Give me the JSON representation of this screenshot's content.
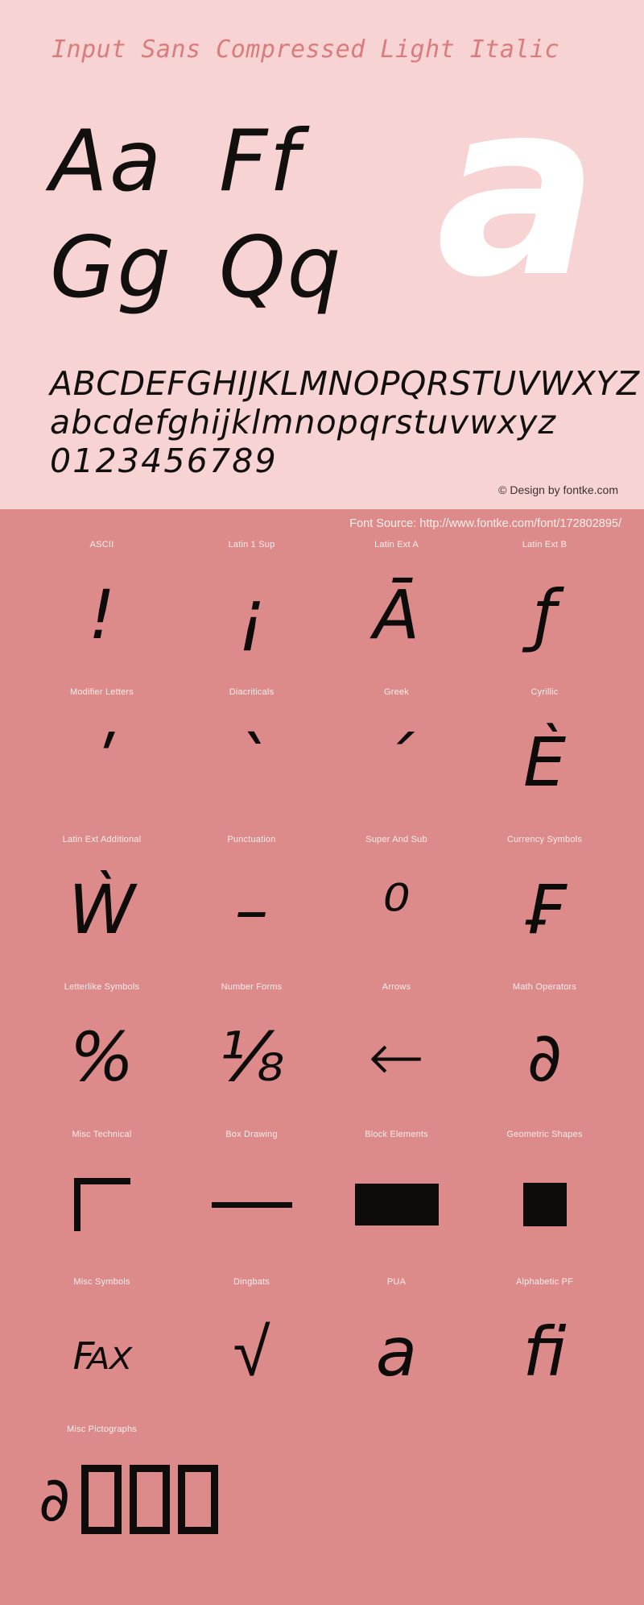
{
  "specimen": {
    "title": "Input Sans Compressed Light Italic",
    "watermark_glyph": "a",
    "letter_pairs": [
      [
        "Aa",
        "Ff"
      ],
      [
        "Gg",
        "Qq"
      ]
    ],
    "charset": {
      "uppercase": "ABCDEFGHIJKLMNOPQRSTUVWXYZ",
      "lowercase": "abcdefghijklmnopqrstuvwxyz",
      "digits": "0123456789"
    },
    "credit": "© Design by fontke.com",
    "source": "Font Source: http://www.fontke.com/font/172802895/"
  },
  "colors": {
    "top_background": "#f8d3d3",
    "bottom_background": "#dd8a8a",
    "title_text": "#d97c7c",
    "glyph_text": "#0d0c0b",
    "label_text": "#fbeeee",
    "watermark": "#ffffff"
  },
  "unicode_blocks": [
    [
      {
        "label": "ASCII",
        "glyph": "!",
        "style": ""
      },
      {
        "label": "Latin 1 Sup",
        "glyph": "¡",
        "style": ""
      },
      {
        "label": "Latin Ext A",
        "glyph": "Ā",
        "style": ""
      },
      {
        "label": "Latin Ext B",
        "glyph": "ƒ",
        "style": ""
      }
    ],
    [
      {
        "label": "Modifier Letters",
        "glyph": "ʹ",
        "style": ""
      },
      {
        "label": "Diacriticals",
        "glyph": "ˋ",
        "style": ""
      },
      {
        "label": "Greek",
        "glyph": "΄",
        "style": ""
      },
      {
        "label": "Cyrillic",
        "glyph": "Ѐ",
        "style": ""
      }
    ],
    [
      {
        "label": "Latin Ext Additional",
        "glyph": "Ẁ",
        "style": ""
      },
      {
        "label": "Punctuation",
        "glyph": "–",
        "style": ""
      },
      {
        "label": "Super And Sub",
        "glyph": "⁰",
        "style": ""
      },
      {
        "label": "Currency Symbols",
        "glyph": "₣",
        "style": ""
      }
    ],
    [
      {
        "label": "Letterlike Symbols",
        "glyph": "%",
        "style": ""
      },
      {
        "label": "Number Forms",
        "glyph": "⅛",
        "style": ""
      },
      {
        "label": "Arrows",
        "glyph": "←",
        "style": "upright"
      },
      {
        "label": "Math Operators",
        "glyph": "∂",
        "style": ""
      }
    ],
    [
      {
        "label": "Misc Technical",
        "glyph": "⌐",
        "style": "shape-corner"
      },
      {
        "label": "Box Drawing",
        "glyph": "─",
        "style": "shape-bar"
      },
      {
        "label": "Block Elements",
        "glyph": "▬",
        "style": "shape-blockel"
      },
      {
        "label": "Geometric Shapes",
        "glyph": "■",
        "style": "shape-square"
      }
    ],
    [
      {
        "label": "Misc Symbols",
        "glyph": "℻",
        "style": "small"
      },
      {
        "label": "Dingbats",
        "glyph": "√",
        "style": "upright"
      },
      {
        "label": "PUA",
        "glyph": "a",
        "style": ""
      },
      {
        "label": "Alphabetic PF",
        "glyph": "ﬁ",
        "style": ""
      }
    ],
    [
      {
        "label": "Misc Pictographs",
        "glyph": "∂",
        "style": "pictos",
        "tofu_count": 3
      }
    ]
  ]
}
